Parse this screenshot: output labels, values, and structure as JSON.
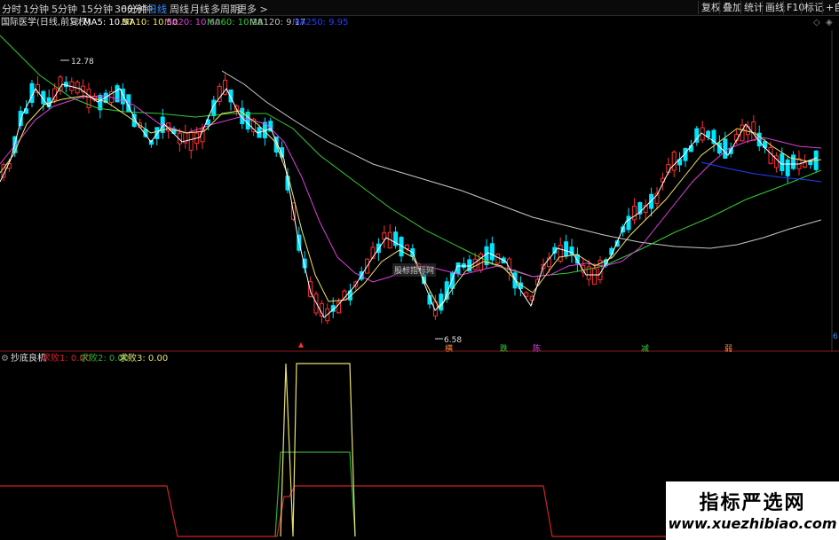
{
  "toolbar": {
    "periods": [
      "分时",
      "1分钟",
      "5分钟",
      "15分钟",
      "30分钟",
      "60分钟",
      "日线",
      "周线",
      "月线",
      "多周期",
      "更多 >"
    ],
    "active_period": "日线",
    "right_buttons": [
      "复权",
      "叠加",
      "统计",
      "画线",
      "F10",
      "标记",
      "+自"
    ]
  },
  "stock": {
    "title": "国际医学(日线,前复权)",
    "ma5": "MA5: 10.57",
    "ma10": "MA10: 10.50",
    "ma20": "MA20: 10.60",
    "ma60": "MA60: 10.28",
    "ma120": "MA120: 9.17",
    "ma250": "MA250: 9.95"
  },
  "chart": {
    "high_label": "12.78",
    "low_label": "6.58",
    "mid_watermark": "股标指标网",
    "signals": [
      "横",
      "跌",
      "陈",
      "减",
      "弱"
    ],
    "right_marker": "6"
  },
  "indicator": {
    "name": "抄底良机",
    "v1": "求败1: 0.00",
    "v2": "求败2: 0.00",
    "v3": "求败3: 0.00"
  },
  "colors": {
    "up": "#ff3030",
    "down": "#00e5ff",
    "ma5": "#ffffff",
    "ma10": "#f5e46b",
    "ma20": "#e040e0",
    "ma60": "#33cc33",
    "ma120": "#c0c0c0",
    "ma250": "#2040ff",
    "ind1": "#d4202a",
    "ind2": "#33aa33",
    "ind3": "#e8e070"
  },
  "watermark": {
    "cn": "指标严选网",
    "en": "www.xuezhibiao.com"
  }
}
